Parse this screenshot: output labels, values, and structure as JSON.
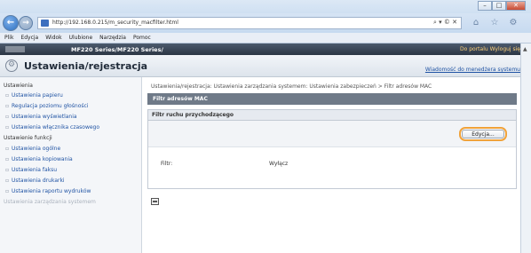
{
  "browser": {
    "url": "http://192.168.0.215/m_security_macfilter.html",
    "address_tools": "⌕ ▾ © ✕",
    "window_buttons": [
      "–",
      "□",
      "✕"
    ],
    "back_glyph": "←",
    "forward_glyph": "→",
    "menu": [
      "Plik",
      "Edycja",
      "Widok",
      "Ulubione",
      "Narzędzia",
      "Pomoc"
    ],
    "toolbar_icons": [
      "home-icon",
      "favorites-icon",
      "gear-icon"
    ],
    "toolbar_glyphs": [
      "⌂",
      "☆",
      "⚙"
    ]
  },
  "header": {
    "model": "MF220 Series/MF220 Series/",
    "link_portal": "Do portalu",
    "link_logout": "Wyloguj się",
    "separator": " "
  },
  "title": {
    "text": "Ustawienia/rejestracja",
    "admin_link": "Wiadomość do menedżera systemu",
    "gear_glyph": "⚙"
  },
  "sidebar": {
    "heading": "Ustawienia",
    "items": [
      "Ustawienia papieru",
      "Regulacja poziomu głośności",
      "Ustawienia wyświetlania",
      "Ustawienia włącznika czasowego"
    ],
    "section2": "Ustawienie funkcji",
    "items2": [
      "Ustawienia ogólne",
      "Ustawienia kopiowania",
      "Ustawienia faksu",
      "Ustawienia drukarki",
      "Ustawienia raportu wydruków"
    ],
    "faded": "Ustawienia zarządzania systemem"
  },
  "main": {
    "breadcrumb": "Ustawienia/rejestracja: Ustawienia zarządzania systemem: Ustawienia zabezpieczeń > Filtr adresów MAC",
    "section_title": "Filtr adresów MAC",
    "panel_title": "Filtr ruchu przychodzącego",
    "edit_label": "Edycja...",
    "filter_label": "Filtr:",
    "filter_value": "Wyłącz"
  },
  "icons": {
    "back": "back-arrow-icon",
    "forward": "forward-arrow-icon",
    "print": "print-icon",
    "settings": "gear-icon"
  }
}
